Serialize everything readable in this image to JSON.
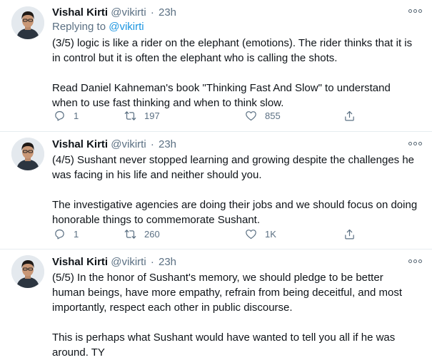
{
  "tweets": [
    {
      "name": "Vishal Kirti",
      "handle": "@vikirti",
      "time": "23h",
      "replying_prefix": "Replying to ",
      "replying_handle": "@vikirti",
      "paragraphs": [
        "(3/5) logic is like a rider on the elephant (emotions). The rider thinks that it is in control but it is often the elephant who is calling the shots.",
        "Read Daniel Kahneman's book \"Thinking Fast And Slow\" to understand when to use fast thinking and when to think slow."
      ],
      "replies": "1",
      "retweets": "197",
      "likes": "855"
    },
    {
      "name": "Vishal Kirti",
      "handle": "@vikirti",
      "time": "23h",
      "paragraphs": [
        "(4/5) Sushant never stopped learning and growing despite the challenges he was facing in his life and neither should you.",
        "The investigative agencies are doing their jobs and we should focus on doing honorable things to commemorate Sushant."
      ],
      "replies": "1",
      "retweets": "260",
      "likes": "1K"
    },
    {
      "name": "Vishal Kirti",
      "handle": "@vikirti",
      "time": "23h",
      "paragraphs": [
        "(5/5) In the honor of Sushant's memory, we should pledge to be better human beings, have more empathy, refrain from being deceitful, and most importantly, respect each other in public discourse.",
        "This is perhaps what Sushant would have wanted to tell you all if he was around. TY"
      ]
    }
  ],
  "icons": {
    "reply": "reply-icon",
    "retweet": "retweet-icon",
    "like": "like-icon",
    "share": "share-icon",
    "more": "more-options-icon"
  },
  "colors": {
    "text": "#0f1419",
    "secondary": "#5b7083",
    "link": "#1b95e0",
    "divider": "#e6ecf0"
  },
  "dot_separator": "·"
}
